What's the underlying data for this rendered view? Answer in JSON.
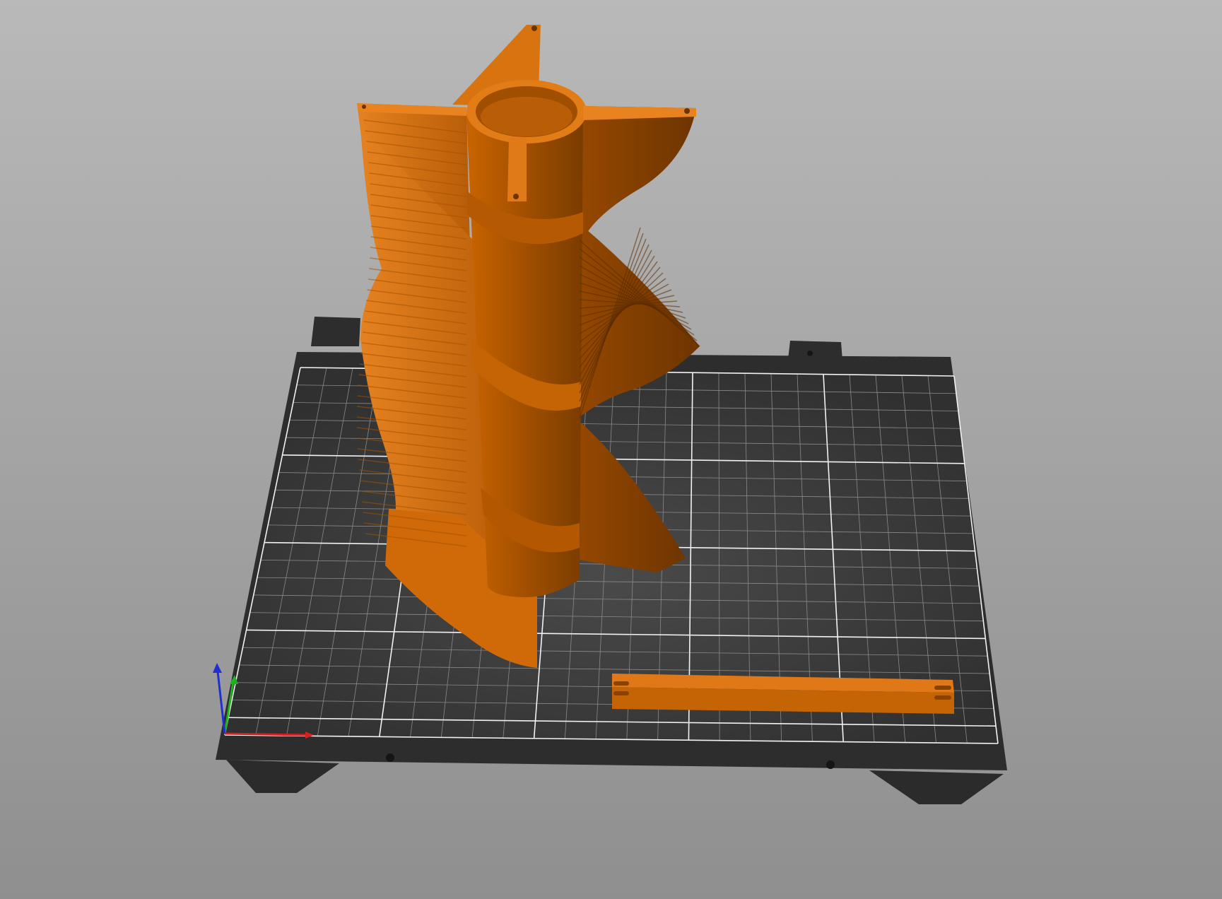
{
  "viewport": {
    "background_top": "#b9b9b9",
    "background_bottom": "#8f8f8f"
  },
  "bed": {
    "surface_color": "#3a3a3a",
    "frame_color": "#2d2d2d",
    "grid_minor_color": "#8a8a8a",
    "grid_major_color": "#f2f2f2",
    "columns": 25,
    "rows": 21
  },
  "objects": [
    {
      "name": "helical-turbine-rotor",
      "color": "#d96f10"
    },
    {
      "name": "mounting-bar",
      "color": "#d96f10"
    }
  ],
  "axes": {
    "x_color": "#d42020",
    "y_color": "#20b020",
    "z_color": "#2030d0"
  }
}
